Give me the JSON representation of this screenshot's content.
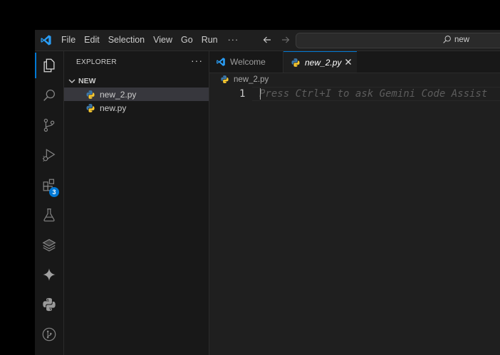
{
  "menu": {
    "items": [
      "File",
      "Edit",
      "Selection",
      "View",
      "Go",
      "Run"
    ],
    "more": "···"
  },
  "search": {
    "text": "new"
  },
  "activity_bar": {
    "items": [
      "explorer-icon",
      "search-icon",
      "source-control-icon",
      "run-debug-icon",
      "extensions-icon",
      "testing-icon",
      "layers-icon",
      "gemini-icon",
      "python-icon",
      "git-graph-icon"
    ],
    "extensions_badge": "3"
  },
  "explorer": {
    "title": "EXPLORER",
    "more": "···",
    "folder": "NEW",
    "files": [
      "new_2.py",
      "new.py"
    ],
    "selected_file": "new_2.py"
  },
  "tabs": [
    {
      "label": "Welcome",
      "active": false
    },
    {
      "label": "new_2.py",
      "active": true
    }
  ],
  "breadcrumb": {
    "file": "new_2.py"
  },
  "editor": {
    "line_number": "1",
    "placeholder": "Press Ctrl+I to ask Gemini Code Assist"
  },
  "colors": {
    "accent": "#0078d4",
    "background": "#1f1f1f",
    "sidebar": "#181818"
  }
}
